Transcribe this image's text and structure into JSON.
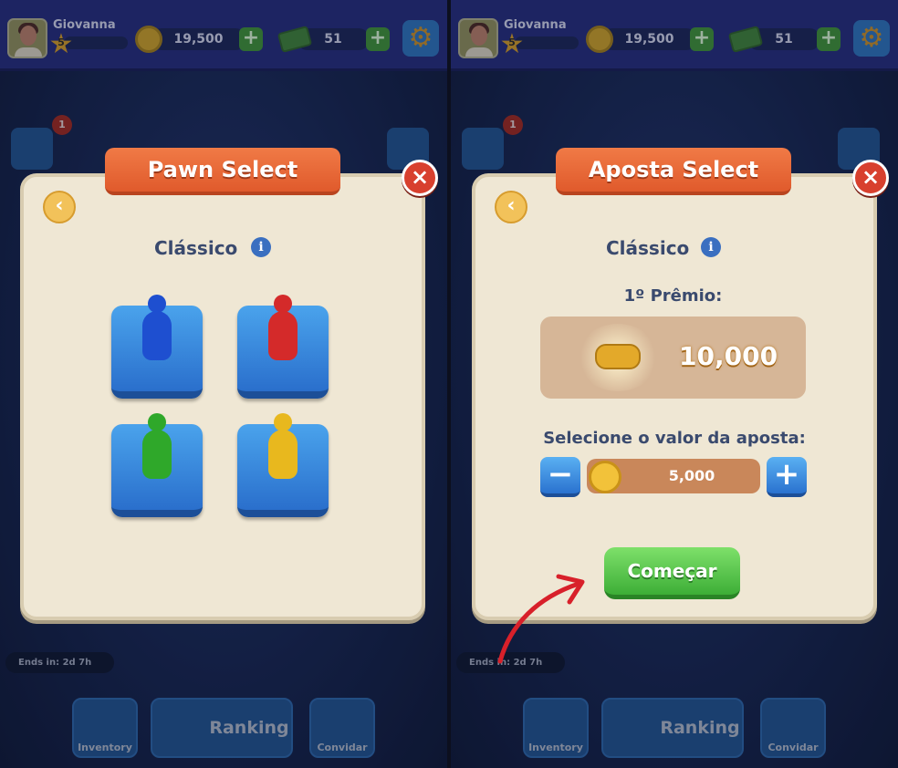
{
  "header": {
    "player_name": "Giovanna",
    "level": "5",
    "coins": "19,500",
    "cash": "51"
  },
  "side": {
    "notification_count": "1"
  },
  "events": {
    "ends_in": "Ends in:  2d 7h"
  },
  "bottom_nav": {
    "inventory": "Inventory",
    "ranking": "Ranking",
    "invite": "Convidar"
  },
  "pawn_dialog": {
    "title": "Pawn Select",
    "mode": "Clássico",
    "pawns": [
      {
        "color": "blue",
        "hex": "#1e4fd0"
      },
      {
        "color": "red",
        "hex": "#d42a2a"
      },
      {
        "color": "green",
        "hex": "#2fa82a"
      },
      {
        "color": "yellow",
        "hex": "#e8b81e"
      }
    ]
  },
  "bet_dialog": {
    "title": "Aposta Select",
    "mode": "Clássico",
    "prize_label": "1º Prêmio:",
    "prize_value": "10,000",
    "select_label": "Selecione o valor da aposta:",
    "bet_value": "5,000",
    "start_button": "Começar"
  },
  "icons": {
    "close": "×",
    "back": "‹",
    "info": "i",
    "plus": "+",
    "minus": "−",
    "gear": "⚙",
    "star": "★"
  },
  "colors": {
    "accent_orange": "#e8673a",
    "start_green": "#4cbf3f",
    "arrow_red": "#d8202a"
  }
}
